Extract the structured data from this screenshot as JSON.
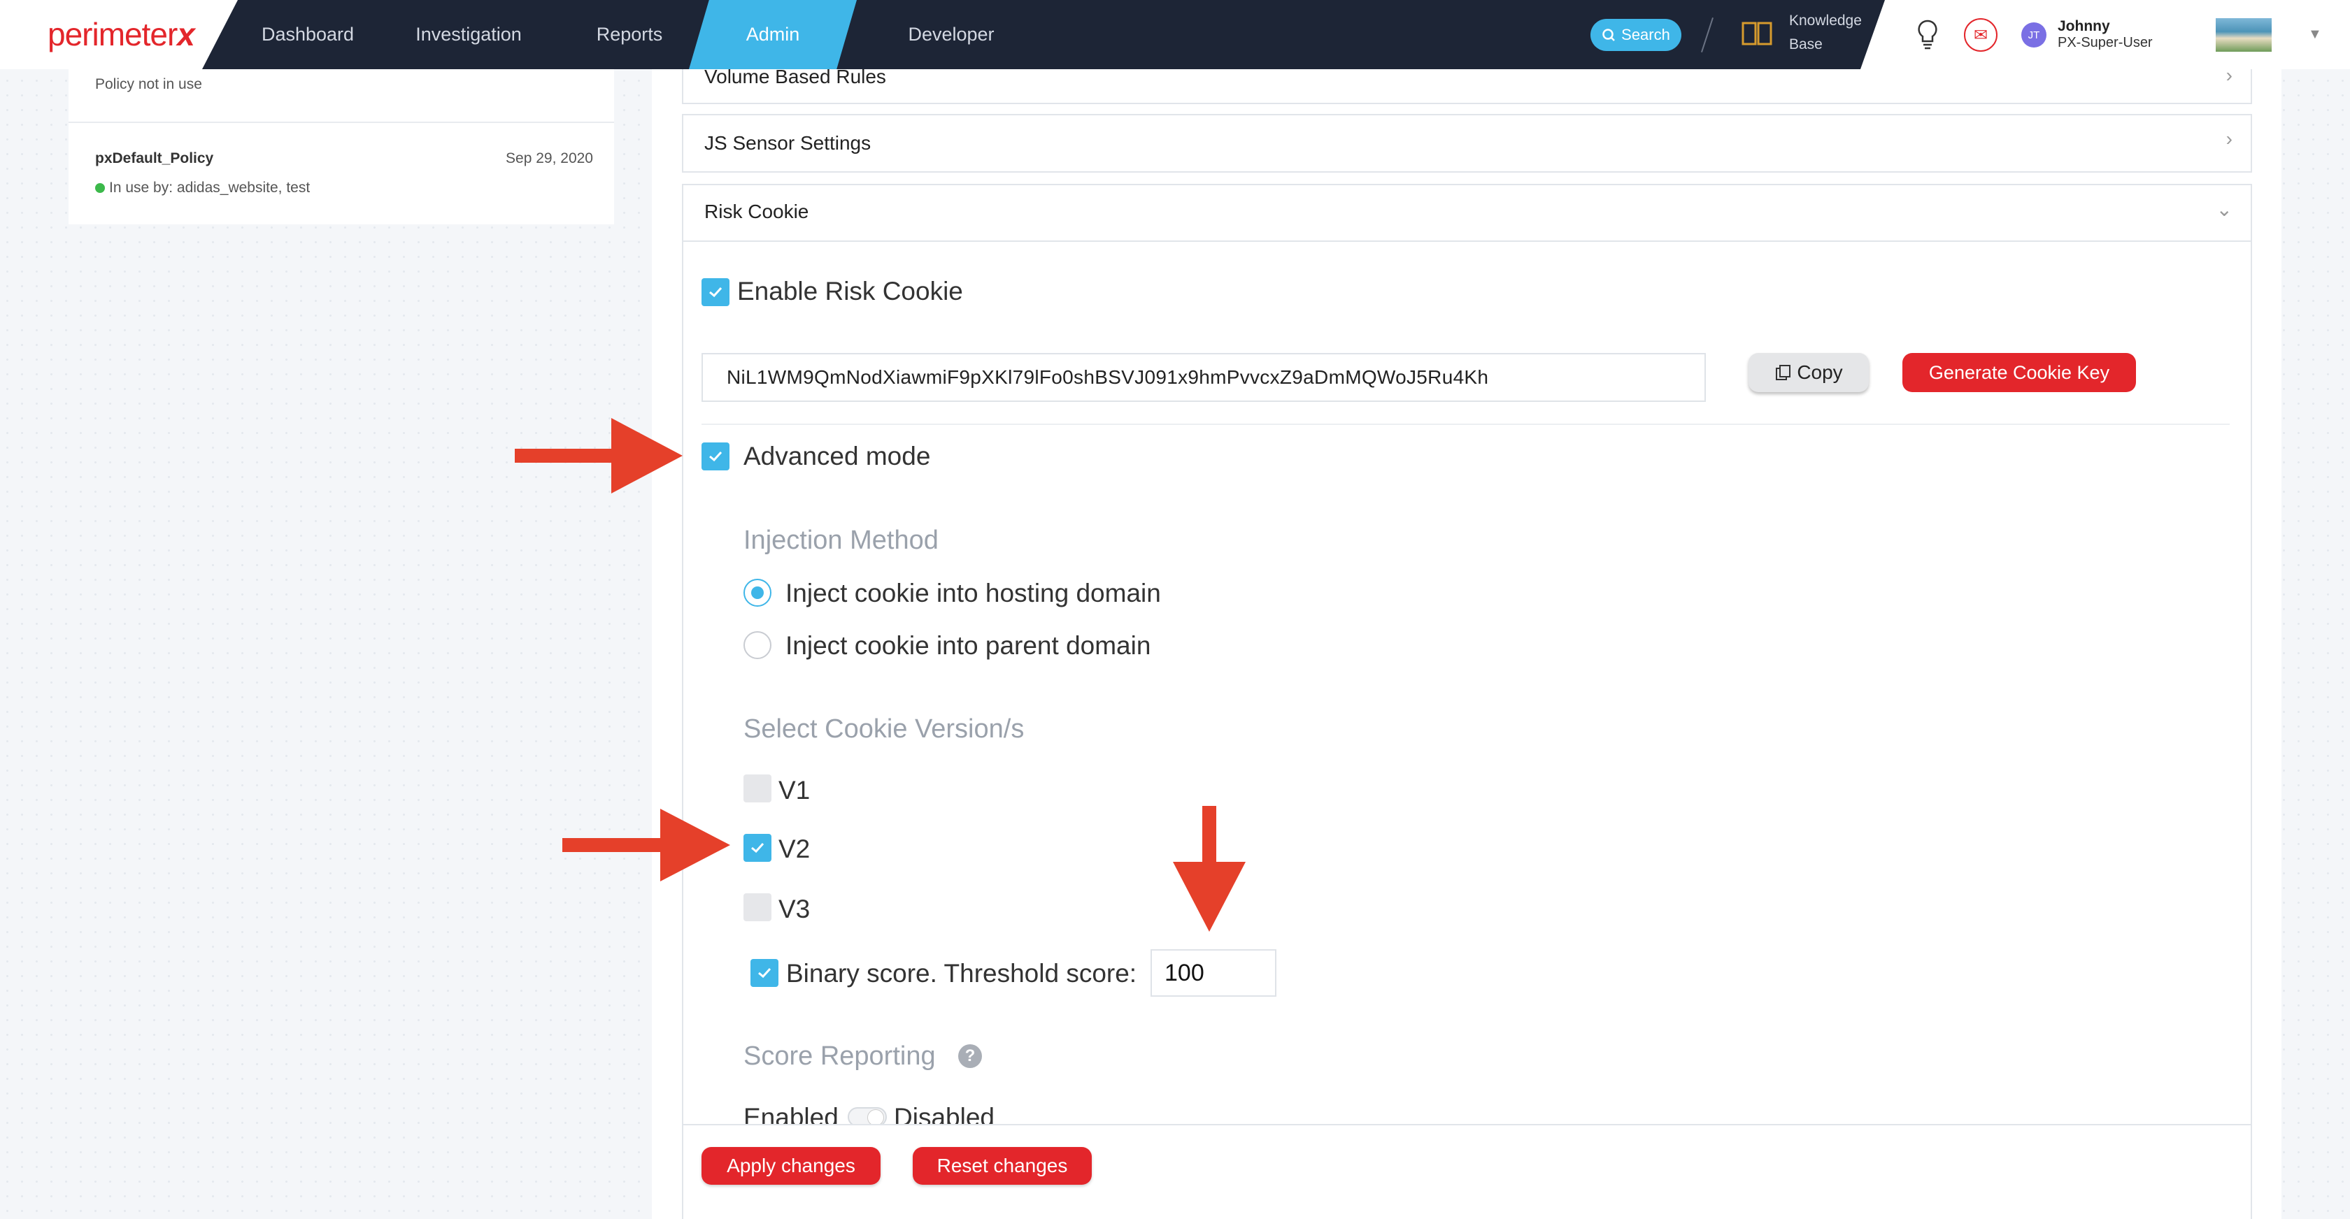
{
  "brand": {
    "logo_text": "perimeter",
    "logo_mark": "x"
  },
  "nav": {
    "items": [
      {
        "label": "Dashboard"
      },
      {
        "label": "Investigation"
      },
      {
        "label": "Reports"
      },
      {
        "label": "Admin",
        "active": true
      },
      {
        "label": "Developer"
      }
    ]
  },
  "header": {
    "search_label": "Search",
    "kb_line1": "Knowledge",
    "kb_line2": "Base",
    "user_initials": "JT",
    "user_name": "Johnny",
    "user_role": "PX-Super-User"
  },
  "policies": {
    "first": {
      "status": "Policy not in use"
    },
    "second": {
      "name": "pxDefault_Policy",
      "date": "Sep 29, 2020",
      "status": "In use by: adidas_website, test"
    }
  },
  "sections": {
    "volume": "Volume Based Rules",
    "js_sensor": "JS Sensor Settings",
    "risk_cookie": "Risk Cookie"
  },
  "risk_cookie": {
    "enable_label": "Enable Risk Cookie",
    "enable_checked": true,
    "cookie_key": "NiL1WM9QmNodXiawmiF9pXKl79lFo0shBSVJ091x9hmPvvcxZ9aDmMQWoJ5Ru4Kh",
    "copy_label": "Copy",
    "generate_label": "Generate Cookie Key",
    "advanced_label": "Advanced mode",
    "advanced_checked": true,
    "injection_heading": "Injection Method",
    "injection_options": [
      {
        "label": "Inject cookie into hosting domain",
        "selected": true
      },
      {
        "label": "Inject cookie into parent domain",
        "selected": false
      }
    ],
    "version_heading": "Select Cookie Version/s",
    "versions": [
      {
        "label": "V1",
        "checked": false
      },
      {
        "label": "V2",
        "checked": true
      },
      {
        "label": "V3",
        "checked": false
      }
    ],
    "binary_label": "Binary score. Threshold score:",
    "binary_checked": true,
    "threshold_value": "100",
    "score_heading": "Score Reporting",
    "score_enabled_label": "Enabled",
    "score_disabled_label": "Disabled",
    "score_enabled": false
  },
  "actions": {
    "apply": "Apply changes",
    "reset": "Reset changes"
  },
  "colors": {
    "accent": "#3fb6e8",
    "brand_red": "#e3262b",
    "nav_bg": "#1d2536",
    "annotation_arrow": "#e5402a"
  }
}
